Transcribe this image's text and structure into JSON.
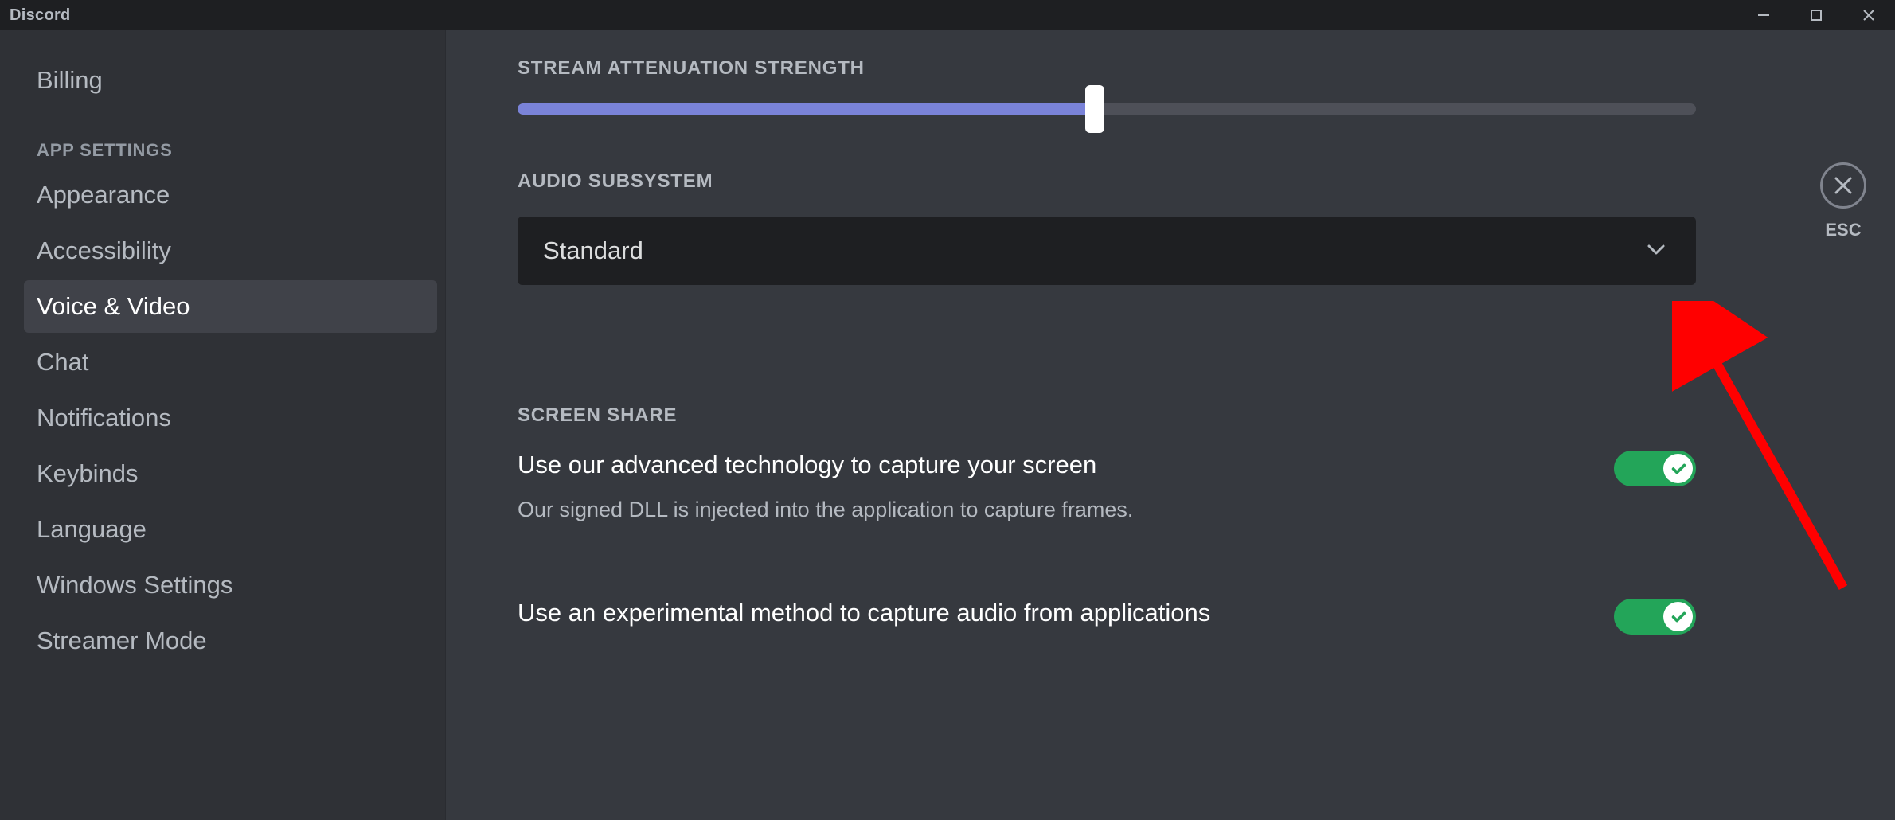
{
  "app": {
    "title": "Discord"
  },
  "close": {
    "esc_label": "ESC"
  },
  "sidebar": {
    "items": {
      "billing": {
        "label": "Billing"
      },
      "appearance": {
        "label": "Appearance"
      },
      "accessibility": {
        "label": "Accessibility"
      },
      "voice_video": {
        "label": "Voice & Video",
        "selected": true
      },
      "chat": {
        "label": "Chat"
      },
      "notifications": {
        "label": "Notifications"
      },
      "keybinds": {
        "label": "Keybinds"
      },
      "language": {
        "label": "Language"
      },
      "windows_settings": {
        "label": "Windows Settings"
      },
      "streamer_mode": {
        "label": "Streamer Mode"
      }
    },
    "section_app": "APP SETTINGS"
  },
  "settings": {
    "attenuation": {
      "heading": "STREAM ATTENUATION STRENGTH",
      "value_pct": 49
    },
    "audio_subsystem": {
      "heading": "AUDIO SUBSYSTEM",
      "value": "Standard"
    },
    "screen_share": {
      "heading": "SCREEN SHARE",
      "advanced_capture": {
        "label": "Use our advanced technology to capture your screen",
        "desc": "Our signed DLL is injected into the application to capture frames.",
        "enabled": true
      },
      "experimental_audio": {
        "label": "Use an experimental method to capture audio from applications",
        "enabled": true
      }
    }
  },
  "colors": {
    "slider_fill": "#7a83d8",
    "toggle_on": "#23a559",
    "annotation": "#ff0000"
  }
}
